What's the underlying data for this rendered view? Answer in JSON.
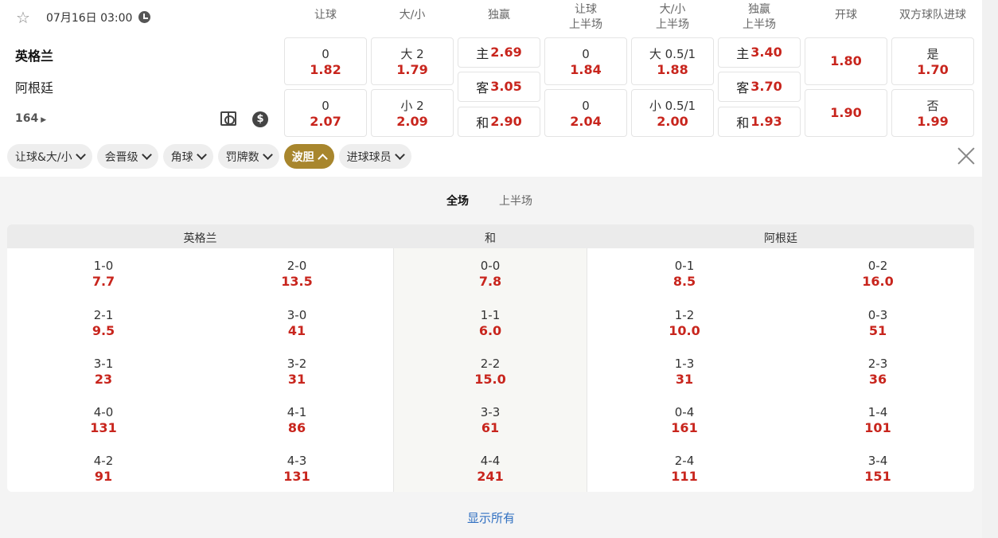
{
  "match": {
    "date": "07月16日 03:00",
    "home": "英格兰",
    "away": "阿根廷",
    "more_markets": "164"
  },
  "columns": [
    {
      "l1": "让球",
      "l2": ""
    },
    {
      "l1": "大/小",
      "l2": ""
    },
    {
      "l1": "独赢",
      "l2": ""
    },
    {
      "l1": "让球",
      "l2": "上半场"
    },
    {
      "l1": "大/小",
      "l2": "上半场"
    },
    {
      "l1": "独赢",
      "l2": "上半场"
    },
    {
      "l1": "开球",
      "l2": ""
    },
    {
      "l1": "双方球队进球",
      "l2": ""
    }
  ],
  "odds": {
    "hdp_home": {
      "line": "0",
      "odd": "1.82"
    },
    "hdp_away": {
      "line": "0",
      "odd": "2.07"
    },
    "ou_over": {
      "line": "大 2",
      "odd": "1.79"
    },
    "ou_under": {
      "line": "小 2",
      "odd": "2.09"
    },
    "x12_home": {
      "label": "主",
      "odd": "2.69"
    },
    "x12_away": {
      "label": "客",
      "odd": "3.05"
    },
    "x12_draw": {
      "label": "和",
      "odd": "2.90"
    },
    "h1_hdp_home": {
      "line": "0",
      "odd": "1.84"
    },
    "h1_hdp_away": {
      "line": "0",
      "odd": "2.04"
    },
    "h1_ou_over": {
      "line": "大 0.5/1",
      "odd": "1.88"
    },
    "h1_ou_under": {
      "line": "小 0.5/1",
      "odd": "2.00"
    },
    "h1_x12_home": {
      "label": "主",
      "odd": "3.40"
    },
    "h1_x12_away": {
      "label": "客",
      "odd": "3.70"
    },
    "h1_x12_draw": {
      "label": "和",
      "odd": "1.93"
    },
    "kickoff_1": {
      "odd": "1.80"
    },
    "kickoff_2": {
      "odd": "1.90"
    },
    "btts_yes": {
      "label": "是",
      "odd": "1.70"
    },
    "btts_no": {
      "label": "否",
      "odd": "1.99"
    }
  },
  "filters": [
    {
      "label": "让球&大/小"
    },
    {
      "label": "会晋级"
    },
    {
      "label": "角球"
    },
    {
      "label": "罚牌数"
    },
    {
      "label": "波胆",
      "active": true
    },
    {
      "label": "进球球员"
    }
  ],
  "tabs": [
    {
      "label": "全场",
      "active": true
    },
    {
      "label": "上半场"
    }
  ],
  "table_head": {
    "home": "英格兰",
    "draw": "和",
    "away": "阿根廷"
  },
  "correct_scores": {
    "home_a": [
      [
        "1-0",
        "7.7"
      ],
      [
        "2-1",
        "9.5"
      ],
      [
        "3-1",
        "23"
      ],
      [
        "4-0",
        "131"
      ],
      [
        "4-2",
        "91"
      ]
    ],
    "home_b": [
      [
        "2-0",
        "13.5"
      ],
      [
        "3-0",
        "41"
      ],
      [
        "3-2",
        "31"
      ],
      [
        "4-1",
        "86"
      ],
      [
        "4-3",
        "131"
      ]
    ],
    "draw": [
      [
        "0-0",
        "7.8"
      ],
      [
        "1-1",
        "6.0"
      ],
      [
        "2-2",
        "15.0"
      ],
      [
        "3-3",
        "61"
      ],
      [
        "4-4",
        "241"
      ]
    ],
    "away_a": [
      [
        "0-1",
        "8.5"
      ],
      [
        "1-2",
        "10.0"
      ],
      [
        "1-3",
        "31"
      ],
      [
        "0-4",
        "161"
      ],
      [
        "2-4",
        "111"
      ]
    ],
    "away_b": [
      [
        "0-2",
        "16.0"
      ],
      [
        "0-3",
        "51"
      ],
      [
        "2-3",
        "36"
      ],
      [
        "1-4",
        "101"
      ],
      [
        "3-4",
        "151"
      ]
    ]
  },
  "show_all": "显示所有"
}
